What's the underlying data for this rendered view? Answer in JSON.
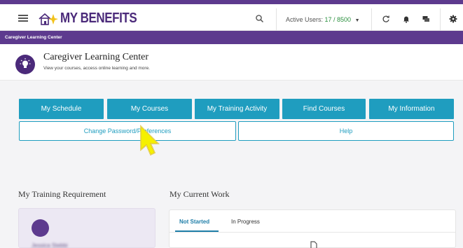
{
  "app": {
    "brand": "MY BENEFITS",
    "brand_color": "#4b2a7a",
    "accent_color": "#1f9dbf"
  },
  "topbar": {
    "active_users_label": "Active Users:",
    "active_users_value": "17 / 8500",
    "icons": [
      "menu-icon",
      "home-icon",
      "search-icon",
      "refresh-icon",
      "bell-icon",
      "chat-icon",
      "gear-icon"
    ]
  },
  "subheader": {
    "label": "Caregiver Learning Center"
  },
  "page_header": {
    "title": "Caregiver Learning Center",
    "subtitle": "View your courses, access online learning and more."
  },
  "nav": {
    "row1": [
      {
        "label": "My Schedule"
      },
      {
        "label": "My Courses"
      },
      {
        "label": "My Training Activity"
      },
      {
        "label": "Find Courses"
      },
      {
        "label": "My Information"
      }
    ],
    "row2": [
      {
        "label": "Change Password/Preferences"
      },
      {
        "label": "Help"
      }
    ]
  },
  "training_requirement": {
    "title": "My Training Requirement",
    "name": "Jessica Stebbi"
  },
  "current_work": {
    "title": "My Current Work",
    "tabs": [
      {
        "label": "Not Started",
        "active": true
      },
      {
        "label": "In Progress",
        "active": false
      }
    ]
  }
}
